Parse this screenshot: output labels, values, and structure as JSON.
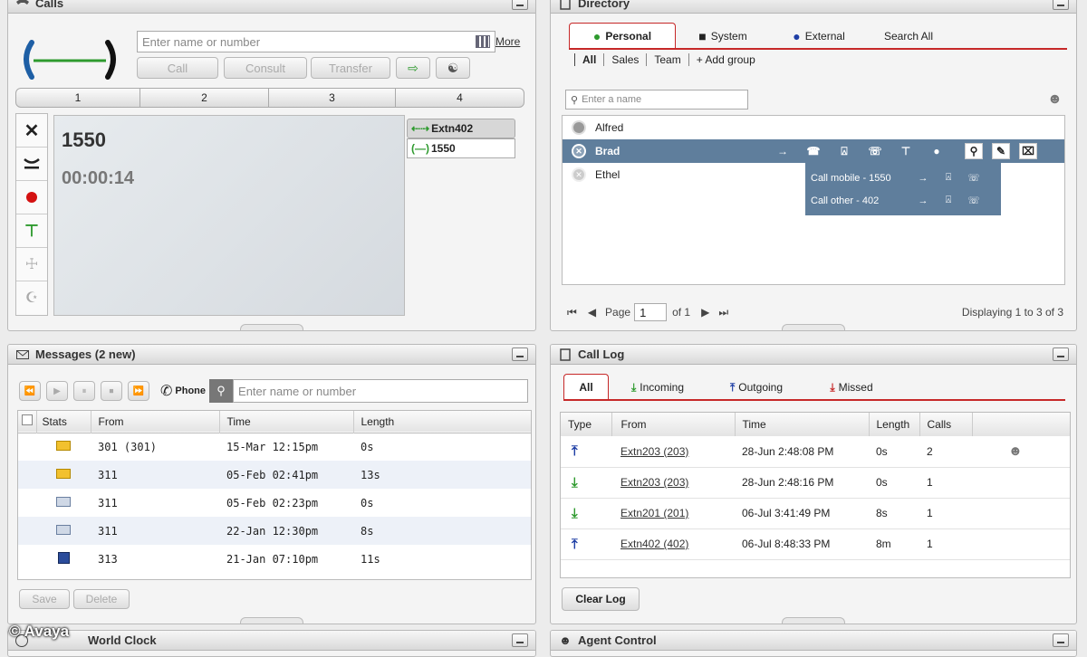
{
  "calls": {
    "title": "Calls",
    "search_placeholder": "Enter name or number",
    "more": "More",
    "buttons": {
      "call": "Call",
      "consult": "Consult",
      "transfer": "Transfer"
    },
    "tabs": [
      "1",
      "2",
      "3",
      "4"
    ],
    "active_number": "1550",
    "timer": "00:00:14",
    "lines": [
      "Extn402",
      "1550"
    ]
  },
  "directory": {
    "title": "Directory",
    "tabs": [
      "Personal",
      "System",
      "External",
      "Search All"
    ],
    "filters": [
      "All",
      "Sales",
      "Team"
    ],
    "add_group": "+ Add group",
    "search_placeholder": "Enter a name",
    "contacts": [
      "Alfred",
      "Brad",
      "Ethel"
    ],
    "call_options": [
      "Call mobile - 1550",
      "Call other - 402"
    ],
    "page_label": "Page",
    "page_value": "1",
    "of_label": "of 1",
    "displaying": "Displaying 1 to 3 of 3"
  },
  "messages": {
    "title": "Messages (2 new)",
    "phone_label": "Phone",
    "search_placeholder": "Enter name or number",
    "columns": [
      "Stats",
      "From",
      "Time",
      "Length"
    ],
    "rows": [
      {
        "from": "301 (301)",
        "time": "15-Mar 12:15pm",
        "length": "0s"
      },
      {
        "from": "311",
        "time": "05-Feb 02:41pm",
        "length": "13s"
      },
      {
        "from": "311",
        "time": "05-Feb 02:23pm",
        "length": "0s"
      },
      {
        "from": "311",
        "time": "22-Jan 12:30pm",
        "length": "8s"
      },
      {
        "from": "313",
        "time": "21-Jan 07:10pm",
        "length": "11s"
      }
    ],
    "save": "Save",
    "delete": "Delete"
  },
  "calllog": {
    "title": "Call Log",
    "tabs": [
      "All",
      "Incoming",
      "Outgoing",
      "Missed"
    ],
    "columns": [
      "Type",
      "From",
      "Time",
      "Length",
      "Calls"
    ],
    "rows": [
      {
        "from": "Extn203 (203)",
        "time": "28-Jun 2:48:08 PM",
        "length": "0s",
        "calls": "2"
      },
      {
        "from": "Extn203 (203)",
        "time": "28-Jun 2:48:16 PM",
        "length": "0s",
        "calls": "1"
      },
      {
        "from": "Extn201 (201)",
        "time": "06-Jul 3:41:49 PM",
        "length": "8s",
        "calls": "1"
      },
      {
        "from": "Extn402 (402)",
        "time": "06-Jul 8:48:33 PM",
        "length": "8m",
        "calls": "1"
      }
    ],
    "clear": "Clear Log"
  },
  "bottom": {
    "world_clock": "World Clock",
    "agent_control": "Agent Control",
    "watermark": "© Avaya"
  },
  "colors": {
    "selection": "#5f7e9c",
    "accent_green": "#2e9a2e",
    "record_red": "#d41111"
  }
}
